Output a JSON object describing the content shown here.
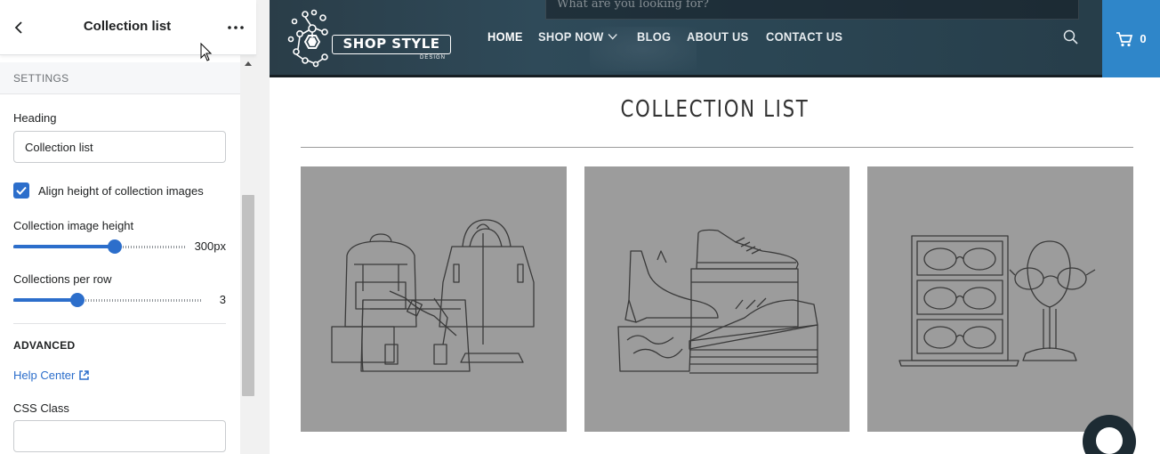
{
  "editor": {
    "title": "Collection list",
    "settings_section": "SETTINGS",
    "heading_label": "Heading",
    "heading_value": "Collection list",
    "align_label": "Align height of collection images",
    "align_checked": true,
    "image_height_label": "Collection image height",
    "image_height_value": "300px",
    "image_height_fraction": 0.59,
    "per_row_label": "Collections per row",
    "per_row_value": "3",
    "per_row_fraction": 0.34,
    "advanced_section": "ADVANCED",
    "help_link": "Help Center",
    "css_class_label": "CSS Class",
    "css_class_value": ""
  },
  "site": {
    "search_placeholder": "What are you looking for?",
    "logo_text": "SHOP STYLE",
    "logo_sub": "DESIGN",
    "nav": [
      "HOME",
      "SHOP NOW",
      "BLOG",
      "ABOUT US",
      "CONTACT US"
    ],
    "cart_count": "0",
    "colors": {
      "header": "#2b4654",
      "cart": "#2f86c9",
      "accent": "#2c6ecb"
    }
  },
  "page": {
    "title": "COLLECTION LIST",
    "collections": [
      "bags-illustration",
      "shoes-illustration",
      "eyeglasses-illustration"
    ]
  },
  "icons": [
    "back-arrow-icon",
    "more-dots-icon",
    "mouse-cursor-icon",
    "scroll-up-arrow-icon",
    "checkmark-icon",
    "external-link-icon",
    "search-icon",
    "cart-icon",
    "chevron-down-icon",
    "chat-icon"
  ]
}
